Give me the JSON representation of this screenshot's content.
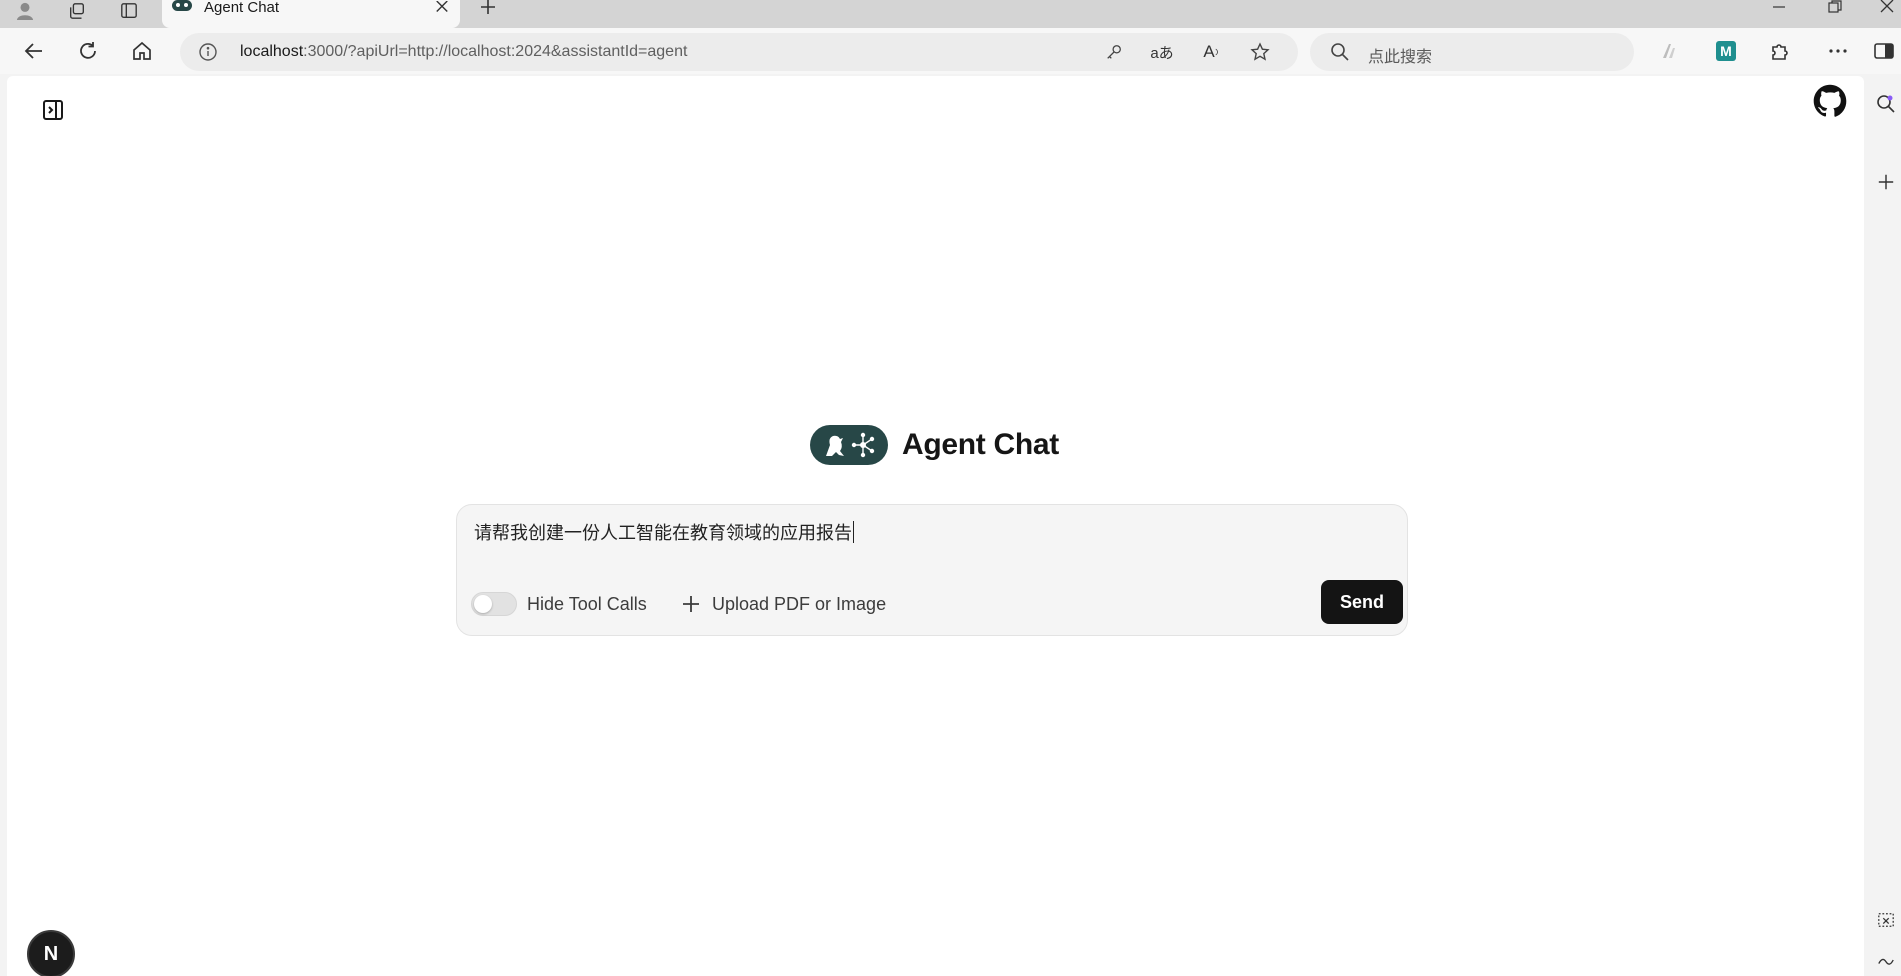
{
  "browser": {
    "tab_title": "Agent Chat",
    "address": {
      "host": "localhost",
      "rest": ":3000/?apiUrl=http://localhost:2024&assistantId=agent"
    },
    "search_placeholder": "点此搜索",
    "translate_glyph": "aあ",
    "read_aloud_glyph": "A",
    "extension_m_glyph": "M"
  },
  "app": {
    "title": "Agent Chat",
    "composer": {
      "value": "请帮我创建一份人工智能在教育领域的应用报告",
      "hide_tool_calls_label": "Hide Tool Calls",
      "hide_tool_calls_on": false,
      "upload_label": "Upload PDF or Image",
      "send_label": "Send"
    },
    "badge_letter": "N"
  },
  "colors": {
    "logo_bg": "#274747",
    "send_bg": "#141414",
    "page_bg": "#ffffff"
  }
}
